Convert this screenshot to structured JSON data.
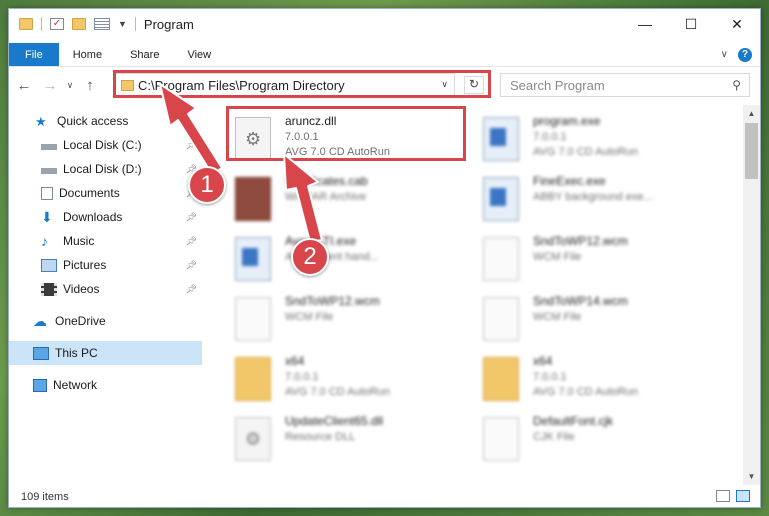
{
  "window": {
    "title": "Program"
  },
  "ribbon": {
    "tabs": [
      "File",
      "Home",
      "Share",
      "View"
    ]
  },
  "nav": {
    "address": "C:\\Program Files\\Program Directory",
    "search_placeholder": "Search Program"
  },
  "sidebar": {
    "items": [
      {
        "label": "Quick access",
        "icon": "star-icon",
        "pinned": false
      },
      {
        "label": "Local Disk (C:)",
        "icon": "drive-icon",
        "pinned": true
      },
      {
        "label": "Local Disk (D:)",
        "icon": "drive-icon",
        "pinned": true
      },
      {
        "label": "Documents",
        "icon": "documents-icon",
        "pinned": true
      },
      {
        "label": "Downloads",
        "icon": "download-icon",
        "pinned": true
      },
      {
        "label": "Music",
        "icon": "music-icon",
        "pinned": true
      },
      {
        "label": "Pictures",
        "icon": "pictures-icon",
        "pinned": true
      },
      {
        "label": "Videos",
        "icon": "videos-icon",
        "pinned": true
      },
      {
        "label": "OneDrive",
        "icon": "cloud-icon",
        "pinned": false
      },
      {
        "label": "This PC",
        "icon": "pc-icon",
        "pinned": false,
        "selected": true
      },
      {
        "label": "Network",
        "icon": "network-icon",
        "pinned": false
      }
    ]
  },
  "files": [
    {
      "name": "aruncz.dll",
      "line2": "7.0.0.1",
      "line3": "AVG 7.0 CD AutoRun",
      "icon": "dll-file-icon",
      "highlighted": true
    },
    {
      "name": "program.exe",
      "line2": "7.0.0.1",
      "line3": "AVG 7.0 CD AutoRun",
      "icon": "exe-file-icon"
    },
    {
      "name": "Certificates.cab",
      "line2": "WinRAR Archive",
      "line3": "",
      "icon": "cab-file-icon"
    },
    {
      "name": "FineExec.exe",
      "line2": "ABBY background exe...",
      "line3": "",
      "icon": "exe-file-icon"
    },
    {
      "name": "AvastSTI.exe",
      "line2": "Avast event hand...",
      "line3": "",
      "icon": "exe-file-icon"
    },
    {
      "name": "SndToWP12.wcm",
      "line2": "WCM File",
      "line3": "",
      "icon": "blank-file-icon"
    },
    {
      "name": "SndToWP12.wcm",
      "line2": "WCM File",
      "line3": "",
      "icon": "blank-file-icon"
    },
    {
      "name": "SndToWP14.wcm",
      "line2": "WCM File",
      "line3": "",
      "icon": "blank-file-icon"
    },
    {
      "name": "x64",
      "line2": "7.0.0.1",
      "line3": "AVG 7.0 CD AutoRun",
      "icon": "folder-icon"
    },
    {
      "name": "x64",
      "line2": "7.0.0.1",
      "line3": "AVG 7.0 CD AutoRun",
      "icon": "folder-icon"
    },
    {
      "name": "UpdateClient65.dll",
      "line2": "Resource DLL",
      "line3": "",
      "icon": "dll-file-icon"
    },
    {
      "name": "DefaultFont.cjk",
      "line2": "CJK File",
      "line3": "",
      "icon": "blank-file-icon"
    }
  ],
  "status": {
    "count": "109 items"
  },
  "annotations": {
    "step1": "1",
    "step2": "2"
  },
  "colors": {
    "accent": "#1979ca",
    "annotation": "#d8454b"
  }
}
